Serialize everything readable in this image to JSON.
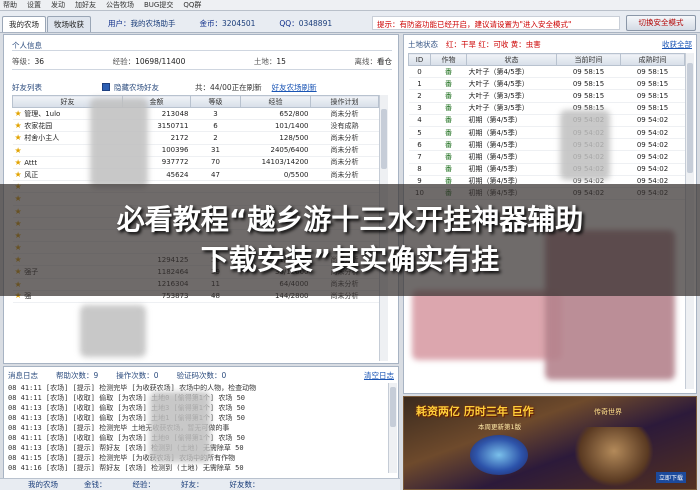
{
  "menu": [
    "帮助",
    "设置",
    "发动",
    "加好友",
    "公告牧场",
    "BUG提交",
    "QQ群"
  ],
  "tabs": [
    "我的农场",
    "牧场收获"
  ],
  "account": {
    "user_label": "用户：",
    "user": "我的农场助手",
    "balance_label": "金币：",
    "balance": "3204501",
    "qq_label": "QQ：",
    "qq": "0348891"
  },
  "alert": "提示：有防盗功能已经开启，建议请设置为\"进入安全模式\"",
  "safe_button": "切换安全模式",
  "info": {
    "title": "个人信息",
    "level_label": "等级：",
    "level": "36",
    "exp_label": "经验：",
    "exp": "10698/11400",
    "land_label": "土地：",
    "land": "15",
    "status_label": "离线：",
    "status": "看仓"
  },
  "friends": {
    "title": "好友列表",
    "checkbox_label": "隐藏农场好友",
    "count": "共：44/00正在刷新",
    "link": "好友农场刷新",
    "columns": [
      "好友",
      "金额",
      "等级",
      "经验",
      "操作计划"
    ],
    "rows": [
      {
        "name": "管理、1ulo",
        "money": "213048",
        "level": "3",
        "exp": "652/800",
        "action": "尚未分析"
      },
      {
        "name": "农家花园",
        "money": "3150711",
        "level": "6",
        "exp": "101/1400",
        "action": "没有成熟"
      },
      {
        "name": "村舍小主人",
        "money": "2172",
        "level": "2",
        "exp": "128/500",
        "action": "尚未分析"
      },
      {
        "name": "",
        "money": "100396",
        "level": "31",
        "exp": "2405/6400",
        "action": "尚未分析"
      },
      {
        "name": "Attt",
        "money": "937772",
        "level": "70",
        "exp": "14103/14200",
        "action": "尚未分析"
      },
      {
        "name": "风正",
        "money": "45624",
        "level": "47",
        "exp": "0/5500",
        "action": "尚未分析"
      },
      {
        "name": "",
        "money": "",
        "level": "",
        "exp": "",
        "action": ""
      },
      {
        "name": "",
        "money": "",
        "level": "",
        "exp": "",
        "action": ""
      },
      {
        "name": "",
        "money": "",
        "level": "",
        "exp": "",
        "action": ""
      },
      {
        "name": "",
        "money": "",
        "level": "",
        "exp": "",
        "action": ""
      },
      {
        "name": "",
        "money": "",
        "level": "",
        "exp": "",
        "action": ""
      },
      {
        "name": "",
        "money": "",
        "level": "",
        "exp": "",
        "action": ""
      },
      {
        "name": "",
        "money": "1294125",
        "level": "56",
        "exp": "1/11000",
        "action": "尚未分析"
      },
      {
        "name": "强子",
        "money": "1182464",
        "level": "39",
        "exp": "36/12000",
        "action": "尚未分析"
      },
      {
        "name": "",
        "money": "1216304",
        "level": "11",
        "exp": "64/4000",
        "action": "尚未分析"
      },
      {
        "name": "强",
        "money": "753873",
        "level": "48",
        "exp": "144/2800",
        "action": "尚未分析"
      }
    ]
  },
  "log": {
    "tabs": [
      "消息日志",
      "帮助次数：9",
      "操作次数：0",
      "验证码次数：0"
    ],
    "link": "清空日志",
    "lines": [
      "08 41:11 [农场] [提示] 检测完毕 [为收获农场] 农场中的人物，检查动物",
      "08 41:11 [农场] [收取] 偷取 [为农场] 土地0 [偷得第1个] 农场 50",
      "08 41:13 [农场] [收取] 偷取 [为农场] 土地3 [偷得第1个] 农场 50",
      "08 41:13 [农场] [收取] 偷取 [为农场] 土地1 [偷得第1个] 农场 50",
      "08 41:13 [农场] [提示] 检测完毕 土地无收获农场，暂无可做的事",
      "08 41:11 [农场] [收取] 偷取 [为农场] 土地0 [偷得第1个] 农场 50",
      "08 41:13 [农场] [提示] 帮好友 [农场] 检测到 (土地) 无需除草 50",
      "08 41:15 [农场] [提示] 检测完毕 [为收获农场] 农场中的所有作物",
      "08 41:16 [农场] [提示] 帮好友 [农场] 检测到 (土地) 无需除草 50"
    ]
  },
  "bottombar": [
    "我的农场",
    "金钱：",
    "经验：",
    "好友：",
    "好友数："
  ],
  "plots": {
    "title": "土地状态",
    "legend": "红：干旱  红：可收  黄：虫害",
    "link": "收获全部",
    "columns": [
      "ID",
      "作物",
      "状态",
      "当前时间",
      "成熟时间"
    ],
    "rows": [
      {
        "id": "0",
        "crop": "番",
        "status": "大叶子（第4/5季）",
        "cur": "09 58:15",
        "ripe": "09 58:15"
      },
      {
        "id": "1",
        "crop": "番",
        "status": "大叶子（第4/5季）",
        "cur": "09 58:15",
        "ripe": "09 58:15"
      },
      {
        "id": "2",
        "crop": "番",
        "status": "大叶子（第3/5季）",
        "cur": "09 58:15",
        "ripe": "09 58:15"
      },
      {
        "id": "3",
        "crop": "番",
        "status": "大叶子（第3/5季）",
        "cur": "09 58:15",
        "ripe": "09 58:15"
      },
      {
        "id": "4",
        "crop": "番",
        "status": "初期（第4/5季）",
        "cur": "09 54:02",
        "ripe": "09 54:02"
      },
      {
        "id": "5",
        "crop": "番",
        "status": "初期（第4/5季）",
        "cur": "09 54:02",
        "ripe": "09 54:02"
      },
      {
        "id": "6",
        "crop": "番",
        "status": "初期（第4/5季）",
        "cur": "09 54:02",
        "ripe": "09 54:02"
      },
      {
        "id": "7",
        "crop": "番",
        "status": "初期（第4/5季）",
        "cur": "09 54:02",
        "ripe": "09 54:02"
      },
      {
        "id": "8",
        "crop": "番",
        "status": "初期（第4/5季）",
        "cur": "09 54:02",
        "ripe": "09 54:02"
      },
      {
        "id": "9",
        "crop": "番",
        "status": "初期（第4/5季）",
        "cur": "09 54:02",
        "ripe": "09 54:02"
      },
      {
        "id": "10",
        "crop": "番",
        "status": "初期（第4/5季）",
        "cur": "09 54:02",
        "ripe": "09 54:02"
      }
    ]
  },
  "ad": {
    "title": "耗资两亿 历时三年 巨作",
    "subtitle": "本周更新第1版",
    "right": "传奇世界",
    "mark": "立即下载"
  },
  "overlay": {
    "line1": "必看教程“越乡游十三水开挂神器辅助",
    "line2": "下载安装”其实确实有挂"
  },
  "colors": {
    "alert": "#cc0000",
    "accent": "#2d4d7f",
    "link": "#1a55b5",
    "star": "#e2a300"
  }
}
